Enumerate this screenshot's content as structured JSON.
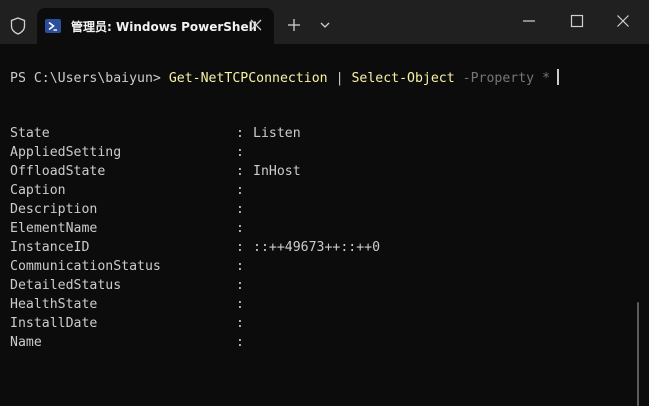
{
  "tab": {
    "title": "管理员: Windows PowerShell"
  },
  "icons": {
    "shield": "shield-icon",
    "powershell": "powershell-icon",
    "tab_close": "close-icon",
    "new_tab": "plus-icon",
    "dropdown": "chevron-down-icon",
    "minimize": "minimize-icon",
    "maximize": "maximize-icon",
    "close": "close-icon"
  },
  "colors": {
    "titlebar": "#202020",
    "terminal_bg": "#0c0c0c",
    "text": "#cccccc",
    "command": "#f9f1a5",
    "parameter": "#767676",
    "tab_icon_bg": "#2c4f9c"
  },
  "terminal": {
    "prompt": "PS C:\\Users\\baiyun>",
    "cmd_get": "Get-NetTCPConnection",
    "pipe": "|",
    "cmd_select": "Select-Object",
    "param": "-Property",
    "arg": "*",
    "properties": [
      {
        "name": "State",
        "colon": ":",
        "value": "Listen"
      },
      {
        "name": "AppliedSetting",
        "colon": ":",
        "value": ""
      },
      {
        "name": "OffloadState",
        "colon": ":",
        "value": "InHost"
      },
      {
        "name": "Caption",
        "colon": ":",
        "value": ""
      },
      {
        "name": "Description",
        "colon": ":",
        "value": ""
      },
      {
        "name": "ElementName",
        "colon": ":",
        "value": ""
      },
      {
        "name": "InstanceID",
        "colon": ":",
        "value": "::++49673++::++0"
      },
      {
        "name": "CommunicationStatus",
        "colon": ":",
        "value": ""
      },
      {
        "name": "DetailedStatus",
        "colon": ":",
        "value": ""
      },
      {
        "name": "HealthState",
        "colon": ":",
        "value": ""
      },
      {
        "name": "InstallDate",
        "colon": ":",
        "value": ""
      },
      {
        "name": "Name",
        "colon": ":",
        "value": ""
      }
    ]
  }
}
